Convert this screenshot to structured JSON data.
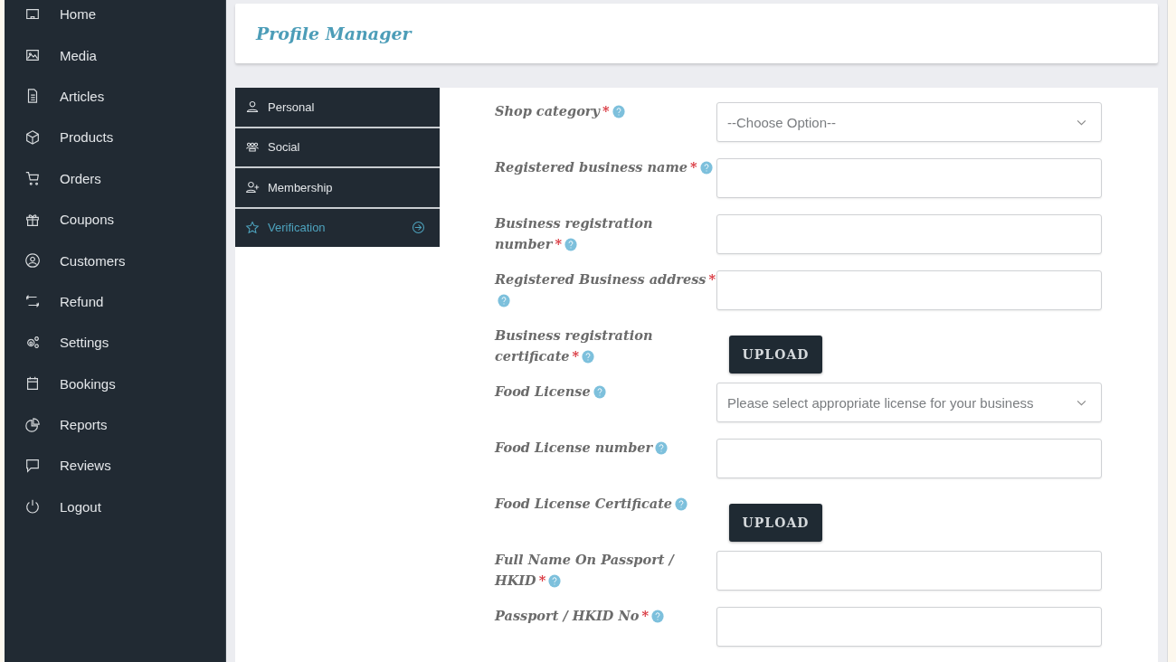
{
  "sidebar": {
    "items": [
      {
        "label": "Home"
      },
      {
        "label": "Media"
      },
      {
        "label": "Articles"
      },
      {
        "label": "Products"
      },
      {
        "label": "Orders"
      },
      {
        "label": "Coupons"
      },
      {
        "label": "Customers"
      },
      {
        "label": "Refund"
      },
      {
        "label": "Settings"
      },
      {
        "label": "Bookings"
      },
      {
        "label": "Reports"
      },
      {
        "label": "Reviews"
      },
      {
        "label": "Logout"
      }
    ]
  },
  "header": {
    "title": "Profile Manager"
  },
  "tabs": [
    {
      "label": "Personal",
      "selected": false
    },
    {
      "label": "Social",
      "selected": false
    },
    {
      "label": "Membership",
      "selected": false
    },
    {
      "label": "Verification",
      "selected": true
    }
  ],
  "fields": [
    {
      "kind": "select",
      "label": "Shop category",
      "mark": "*",
      "placeholder": "--Choose Option--"
    },
    {
      "kind": "text",
      "label": "Registered business name",
      "mark": "*"
    },
    {
      "kind": "text",
      "label": "Business registration number",
      "mark": "*"
    },
    {
      "kind": "text",
      "label": "Registered Business address",
      "mark": "*"
    },
    {
      "kind": "upload",
      "label": "Business registration certificate",
      "mark": "*",
      "button": "UPLOAD"
    },
    {
      "kind": "select",
      "label": "Food License",
      "placeholder": "Please select appropriate license for your business"
    },
    {
      "kind": "text",
      "label": "Food License number"
    },
    {
      "kind": "upload",
      "label": "Food License Certificate",
      "button": "UPLOAD"
    },
    {
      "kind": "text",
      "label": "Full Name On Passport / HKID",
      "mark": "*"
    },
    {
      "kind": "text",
      "label": "Passport / HKID No",
      "mark": "*"
    }
  ]
}
